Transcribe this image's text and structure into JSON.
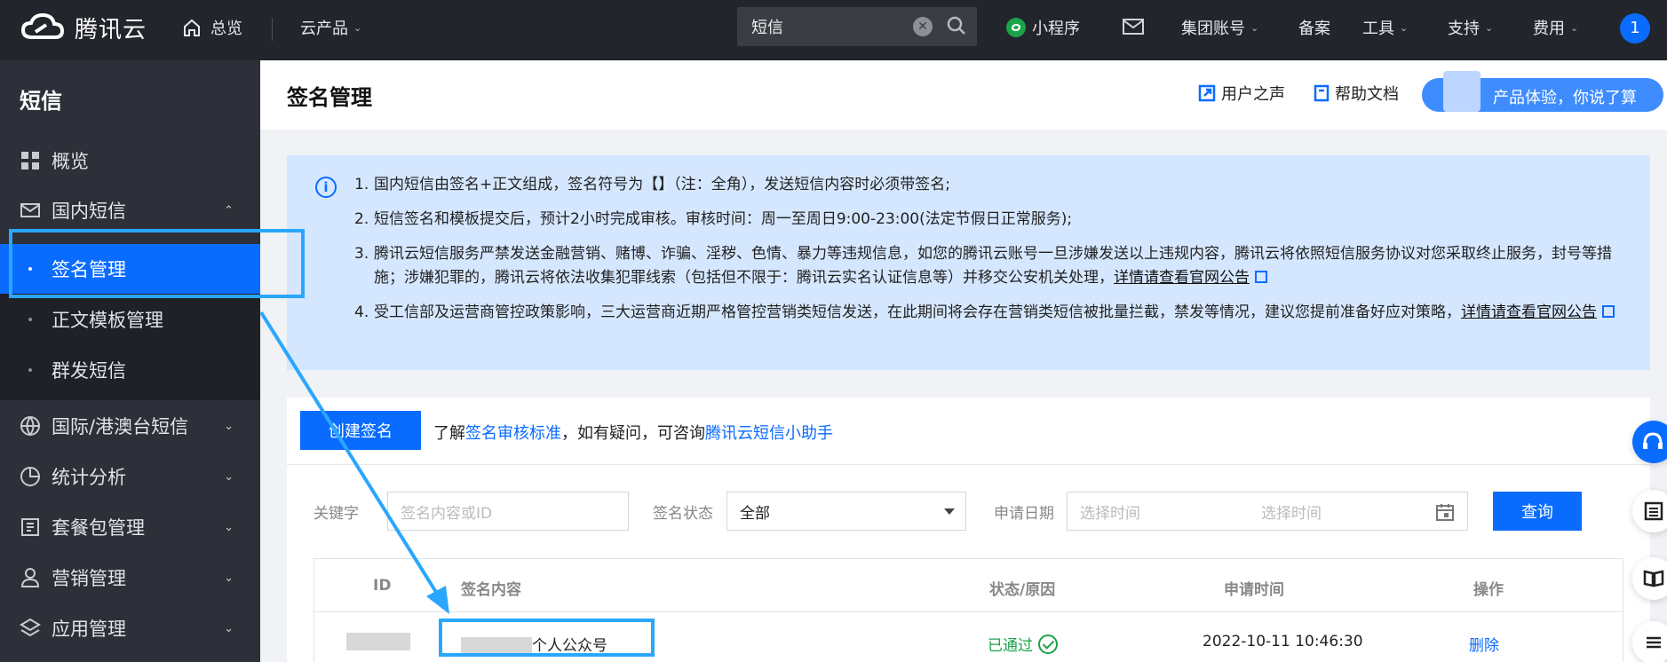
{
  "topbar": {
    "brand": "腾讯云",
    "home": "总览",
    "products": "云产品",
    "search_value": "短信",
    "mini_program": "小程序",
    "group_account": "集团账号",
    "beian": "备案",
    "tools": "工具",
    "support": "支持",
    "billing": "费用",
    "avatar_badge": "1"
  },
  "sidebar": {
    "title": "短信",
    "overview": "概览",
    "domestic": "国内短信",
    "sub_items": [
      "签名管理",
      "正文模板管理",
      "群发短信"
    ],
    "international": "国际/港澳台短信",
    "statistics": "统计分析",
    "packages": "套餐包管理",
    "marketing": "营销管理",
    "apps": "应用管理"
  },
  "header": {
    "title": "签名管理",
    "user_voice": "用户之声",
    "help_doc": "帮助文档",
    "experience": "产品体验，你说了算"
  },
  "notice": {
    "items": [
      {
        "num": "1.",
        "text": "国内短信由签名+正文组成，签名符号为【】（注：全角），发送短信内容时必须带签名;"
      },
      {
        "num": "2.",
        "text": "短信签名和模板提交后，预计2小时完成审核。审核时间：周一至周日9:00-23:00(法定节假日正常服务);"
      },
      {
        "num": "3.",
        "text": "腾讯云短信服务严禁发送金融营销、赌博、诈骗、淫秽、色情、暴力等违规信息，如您的腾讯云账号一旦涉嫌发送以上违规内容，腾讯云将依照短信服务协议对您采取终止服务，封号等措施；涉嫌犯罪的，腾讯云将依法收集犯罪线索（包括但不限于：腾讯云实名认证信息等）并移交公安机关处理，",
        "link": "详情请查看官网公告"
      },
      {
        "num": "4.",
        "text": "受工信部及运营商管控政策影响，三大运营商近期严格管控营销类短信发送，在此期间将会存在营销类短信被批量拦截，禁发等情况，建议您提前准备好应对策略，",
        "link": "详情请查看官网公告"
      }
    ]
  },
  "panel": {
    "create_button": "创建签名",
    "tip_prefix": "了解",
    "tip_link1": "签名审核标准",
    "tip_middle": "，如有疑问，可咨询",
    "tip_link2": "腾讯云短信小助手",
    "filter": {
      "keyword_label": "关键字",
      "keyword_placeholder": "签名内容或ID",
      "status_label": "签名状态",
      "status_value": "全部",
      "date_label": "申请日期",
      "date_start_placeholder": "选择时间",
      "date_end_placeholder": "选择时间",
      "query_button": "查询"
    },
    "table": {
      "columns": [
        "ID",
        "签名内容",
        "状态/原因",
        "申请时间",
        "操作"
      ],
      "rows": [
        {
          "content_suffix": "个人公众号",
          "status": "已通过",
          "time": "2022-10-11 10:46:30",
          "action": "删除"
        }
      ]
    }
  },
  "colors": {
    "accent": "#0a6cff",
    "topbar_bg": "#22252b",
    "sidebar_bg": "#2d3038",
    "notice_bg": "#d5e7ff",
    "success": "#1ca34a",
    "annotation": "#2aa6ff"
  }
}
